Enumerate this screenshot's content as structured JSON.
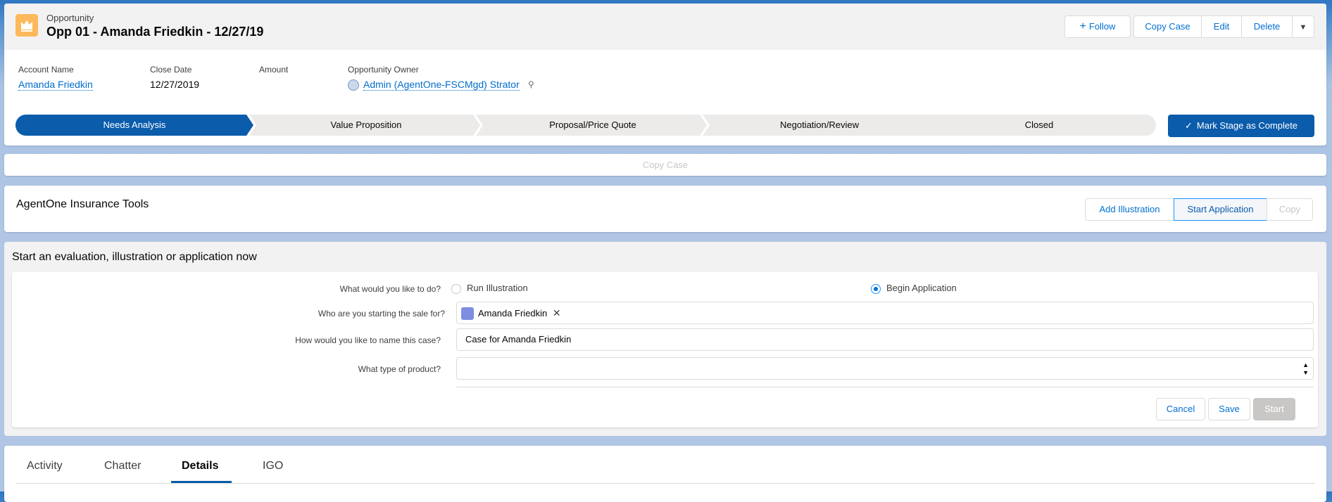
{
  "header": {
    "object_type": "Opportunity",
    "record_title": "Opp 01 - Amanda Friedkin - 12/27/19",
    "actions": {
      "follow": "Follow",
      "copy_case": "Copy Case",
      "edit": "Edit",
      "delete": "Delete"
    }
  },
  "highlights": {
    "account_name_label": "Account Name",
    "account_name": "Amanda Friedkin",
    "close_date_label": "Close Date",
    "close_date": "12/27/2019",
    "amount_label": "Amount",
    "owner_label": "Opportunity Owner",
    "owner": "Admin (AgentOne-FSCMgd) Strator"
  },
  "path": {
    "steps": [
      "Needs Analysis",
      "Value Proposition",
      "Proposal/Price Quote",
      "Negotiation/Review",
      "Closed"
    ],
    "mark_complete": "Mark Stage as Complete",
    "active_color": "#0b5cab"
  },
  "copy_case_bar": {
    "label": "Copy Case"
  },
  "tools": {
    "title": "AgentOne Insurance Tools",
    "add_illustration": "Add Illustration",
    "start_application": "Start Application",
    "copy": "Copy"
  },
  "evaluation": {
    "title": "Start an evaluation, illustration or application now",
    "q_what": "What would you like to do?",
    "opt_run": "Run Illustration",
    "opt_begin": "Begin Application",
    "q_who": "Who are you starting the sale for?",
    "who_value": "Amanda Friedkin",
    "q_name": "How would you like to name this case?",
    "name_value": "Case for Amanda Friedkin",
    "q_product": "What type of product?",
    "product_value": "",
    "cancel": "Cancel",
    "save": "Save",
    "start": "Start"
  },
  "tabs": [
    "Activity",
    "Chatter",
    "Details",
    "IGO"
  ],
  "active_tab": "Details"
}
